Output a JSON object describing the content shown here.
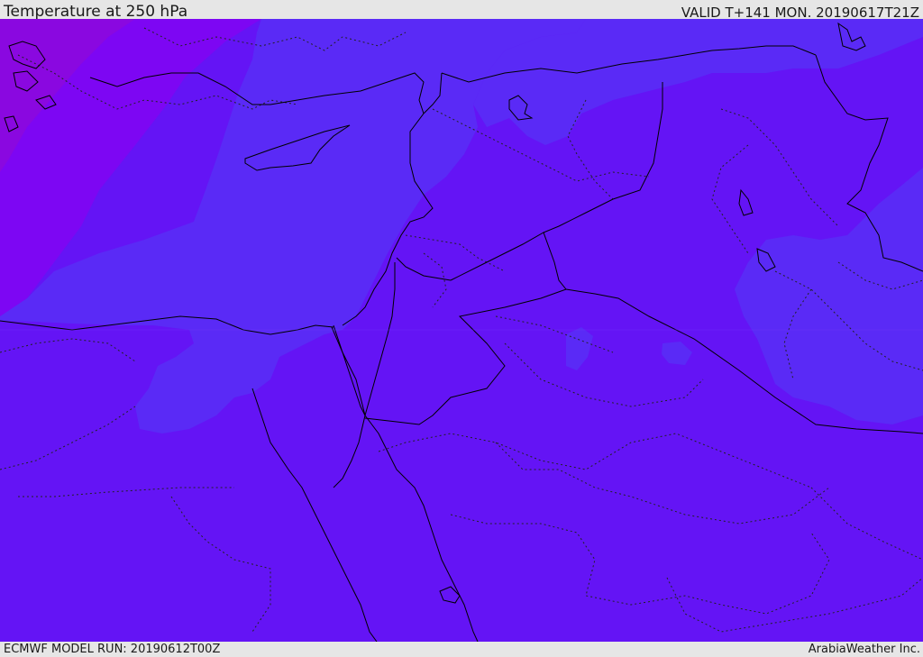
{
  "header": {
    "title": "Temperature at 250 hPa",
    "valid": "VALID T+141 MON. 20190617T21Z"
  },
  "footer": {
    "model_run": "ECMWF MODEL RUN: 20190612T00Z",
    "credit": "ArabiaWeather Inc."
  },
  "colors": {
    "base_field": "#6414f5",
    "cool_field": "#5a2af6",
    "warm_field": "#7d06f3",
    "warmest_field": "#8a08e0",
    "borders": "#000000"
  }
}
